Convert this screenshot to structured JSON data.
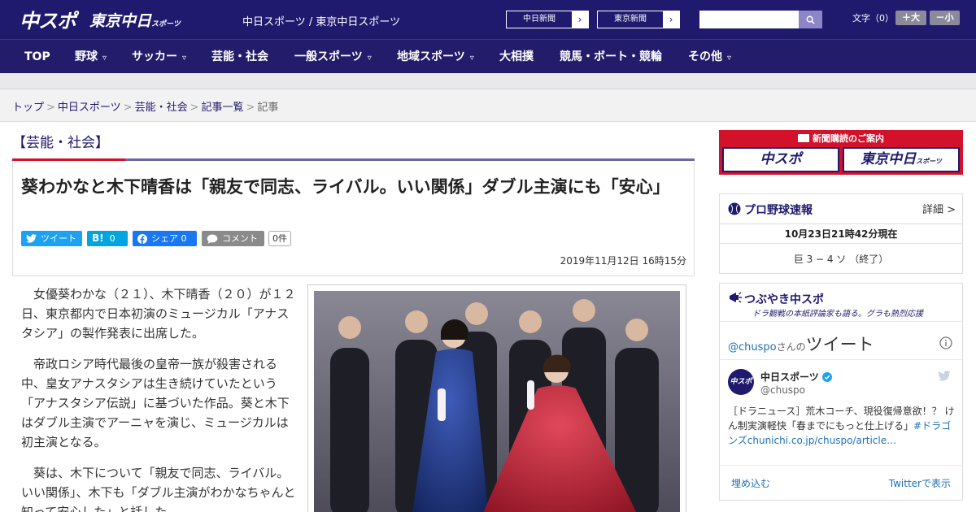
{
  "header": {
    "logo_chunichi": "中スポ",
    "logo_tokyo": "東京中日",
    "logo_tokyo_sub": "スポーツ",
    "site_name": "中日スポーツ / 東京中日スポーツ",
    "paper_links": [
      "中日新聞",
      "東京新聞"
    ],
    "search": {
      "placeholder": "",
      "icon": "search-icon"
    },
    "font_size": {
      "label": "文字（0）",
      "larger": "＋大",
      "smaller": "－小"
    }
  },
  "nav": {
    "items": [
      {
        "label": "TOP",
        "dropdown": false
      },
      {
        "label": "野球",
        "dropdown": true
      },
      {
        "label": "サッカー",
        "dropdown": true
      },
      {
        "label": "芸能・社会",
        "dropdown": false
      },
      {
        "label": "一般スポーツ",
        "dropdown": true
      },
      {
        "label": "地域スポーツ",
        "dropdown": true
      },
      {
        "label": "大相撲",
        "dropdown": false
      },
      {
        "label": "競馬・ボート・競輪",
        "dropdown": false
      },
      {
        "label": "その他",
        "dropdown": true
      }
    ]
  },
  "breadcrumb": {
    "items": [
      "トップ",
      "中日スポーツ",
      "芸能・社会",
      "記事一覧"
    ],
    "current": "記事"
  },
  "article": {
    "category": "【芸能・社会】",
    "headline": "葵わかなと木下晴香は「親友で同志、ライバル。いい関係」ダブル主演にも「安心」",
    "share": {
      "tweet": "ツイート",
      "hatena_count": "0",
      "facebook": "シェア 0",
      "comment": "コメント",
      "comment_count": "0件"
    },
    "date": "2019年11月12日 16時15分",
    "paragraphs": [
      "女優葵わかな（２１）、木下晴香（２０）が１２日、東京都内で日本初演のミュージカル「アナスタシア」の製作発表に出席した。",
      "帝政ロシア時代最後の皇帝一族が殺害される中、皇女アナスタシアは生き続けていたという「アナスタシア伝説」に基づいた作品。葵と木下はダブル主演でアーニャを演じ、ミュージカルは初主演となる。",
      "葵は、木下について「親友で同志、ライバル。いい関係」、木下も「ダブル主演がわかなちゃんと知って安心した」と話した。"
    ]
  },
  "sidebar": {
    "subscribe": {
      "title": "新聞購読のご案内",
      "buttons": [
        "中スポ",
        "東京中日"
      ],
      "button_sub": "スポーツ"
    },
    "baseball": {
      "title": "プロ野球速報",
      "detail": "詳細 >",
      "timestamp": "10月23日21時42分現在",
      "score": "巨 3 − 4 ソ （終了）"
    },
    "twitter": {
      "title": "つぶやき中スポ",
      "subtitle": "ドラ観戦の本紙評論家も語る。グラも熱烈応援",
      "header_handle": "@chuspo",
      "header_suffix": "さんの",
      "header_main": "ツイート",
      "account_name": "中日スポーツ",
      "account_handle": "@chuspo",
      "avatar_text": "中スポ",
      "tweet_text": "［ドラニュース］荒木コーチ、現役復帰意欲！？ けん制実演軽快「春までにもっと仕上げる」",
      "tweet_link": "#ドラゴンズchunichi.co.jp/chuspo/article…",
      "embed": "埋め込む",
      "view_on": "Twitterで表示"
    }
  },
  "colors": {
    "navy": "#1f1a6e",
    "red": "#d4112b",
    "twitter": "#1da1f2",
    "hatena": "#00a4de",
    "facebook": "#1877f2"
  }
}
